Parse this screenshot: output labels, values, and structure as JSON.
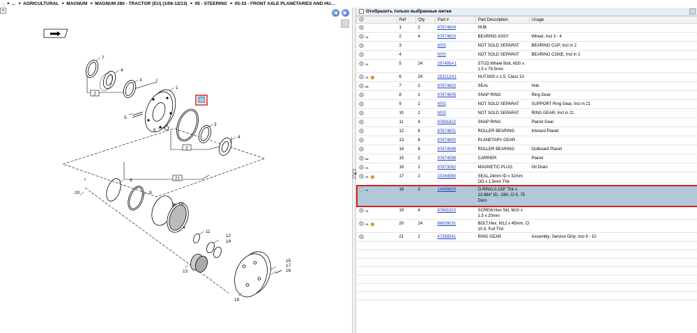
{
  "breadcrumb": {
    "home_icon": "home-icon",
    "items": [
      "...",
      "AGRICULTURAL",
      "MAGNUM",
      "MAGNUM 280 - TRACTOR (EU) (1/06-12/13)",
      "05 - STEERING",
      "05-33 - FRONT AXLE PLANETARIES AND HU..."
    ]
  },
  "left": {
    "mini_btn": "+",
    "nav_prev": "◄",
    "nav_next": "►",
    "callouts": [
      "7",
      "4",
      "3",
      "1",
      "18",
      "3",
      "4",
      "5",
      "6",
      "2",
      "2",
      "21",
      "6",
      "20",
      "9",
      "10",
      "11",
      "12",
      "14",
      "13",
      "15",
      "17",
      "16",
      "19"
    ]
  },
  "right": {
    "filter_label": "Отобразить только выбранные метки",
    "columns": [
      "",
      "Ref",
      "Qty",
      "Part #",
      "Part Description",
      "Usage"
    ],
    "rows": [
      {
        "ref": "1",
        "qty": "2",
        "part": "87674604",
        "desc": "HUB",
        "usage": "",
        "icons": [],
        "h": "r1"
      },
      {
        "ref": "2",
        "qty": "4",
        "part": "87674603",
        "desc": "BEARING ASSY",
        "usage": "Wheel, Incl 3 - 4",
        "icons": [
          "blue"
        ],
        "h": "r1"
      },
      {
        "ref": "3",
        "qty": "",
        "part": "NSS",
        "desc": "NOT SOLD SEPARAT",
        "usage": "BEARING CUP, Incl in 2",
        "icons": [],
        "h": "r1"
      },
      {
        "ref": "4",
        "qty": "",
        "part": "NSS",
        "desc": "NOT SOLD SEPARAT",
        "usage": "BEARING CONE, Incl in 2",
        "icons": [],
        "h": "r1"
      },
      {
        "ref": "5",
        "qty": "24",
        "part": "297495A1",
        "desc": "STUD,Wheel Bolt, M20 x 1.5 x 79.5mm",
        "usage": "",
        "icons": [
          "blue"
        ],
        "h": "r2"
      },
      {
        "ref": "6",
        "qty": "24",
        "part": "253212A1",
        "desc": "NUT,M20 x 1.5, Class 10",
        "usage": "",
        "icons": [
          "blue",
          "orange"
        ],
        "h": "r1"
      },
      {
        "ref": "7",
        "qty": "2",
        "part": "87674602",
        "desc": "SEAL",
        "usage": "Hub",
        "icons": [
          "green"
        ],
        "h": "r1"
      },
      {
        "ref": "8",
        "qty": "2",
        "part": "87674605",
        "desc": "SNAP RING",
        "usage": "Ring Gear",
        "icons": [],
        "h": "r1"
      },
      {
        "ref": "9",
        "qty": "2",
        "part": "NSS",
        "desc": "NOT SOLD SEPARAT",
        "usage": "SUPPORT Ring Gear, Incl in 21",
        "icons": [],
        "h": "r1"
      },
      {
        "ref": "10",
        "qty": "2",
        "part": "NSS",
        "desc": "NOT SOLD SEPARAT",
        "usage": "RING GEAR, Incl in 21",
        "icons": [],
        "h": "r1"
      },
      {
        "ref": "11",
        "qty": "6",
        "part": "87681822",
        "desc": "SNAP RING",
        "usage": "Planet Gear",
        "icons": [],
        "h": "r1"
      },
      {
        "ref": "12",
        "qty": "6",
        "part": "87674601",
        "desc": "ROLLER BEARING",
        "usage": "Inboard Planet",
        "icons": [],
        "h": "r1"
      },
      {
        "ref": "13",
        "qty": "6",
        "part": "87674600",
        "desc": "PLANETARY GEAR",
        "usage": "",
        "icons": [],
        "h": "r1"
      },
      {
        "ref": "14",
        "qty": "6",
        "part": "87674599",
        "desc": "ROLLER BEARING",
        "usage": "Outboard Planet",
        "icons": [],
        "h": "r1"
      },
      {
        "ref": "15",
        "qty": "2",
        "part": "87674598",
        "desc": "CARRIER",
        "usage": "Planet",
        "icons": [
          "green"
        ],
        "h": "r1"
      },
      {
        "ref": "16",
        "qty": "2",
        "part": "87673062",
        "desc": "MAGNETIC PLUG",
        "usage": "Oil Drain",
        "icons": [
          "blue"
        ],
        "h": "r1"
      },
      {
        "ref": "17",
        "qty": "2",
        "part": "10264560",
        "desc": "SEAL,24mm ID x 32mm OD x 1.5mm Thk",
        "usage": "",
        "icons": [
          "blue",
          "orange"
        ],
        "h": "r2"
      },
      {
        "ref": "18",
        "qty": "2",
        "part": "14469800",
        "desc": "O-RING,0.139\" Thk x 13.984\" ID, -280, Cl 5, 75 Duro",
        "usage": "",
        "icons": [
          "blue"
        ],
        "h": "r3",
        "selected": true
      },
      {
        "ref": "19",
        "qty": "4",
        "part": "87681823",
        "desc": "SCREW,Hex Skt, M10 x 1.5 x 20mm",
        "usage": "",
        "icons": [
          "blue"
        ],
        "h": "r2"
      },
      {
        "ref": "20",
        "qty": "24",
        "part": "86639031",
        "desc": "BOLT,Hex, M12 x 45mm, Cl 10.9, Full Thd",
        "usage": "",
        "icons": [
          "blue",
          "orange"
        ],
        "h": "r2"
      },
      {
        "ref": "21",
        "qty": "2",
        "part": "47388541",
        "desc": "RING GEAR",
        "usage": "Assembly; Service Only; Incl 8 - 10",
        "icons": [],
        "h": "r1"
      }
    ]
  }
}
